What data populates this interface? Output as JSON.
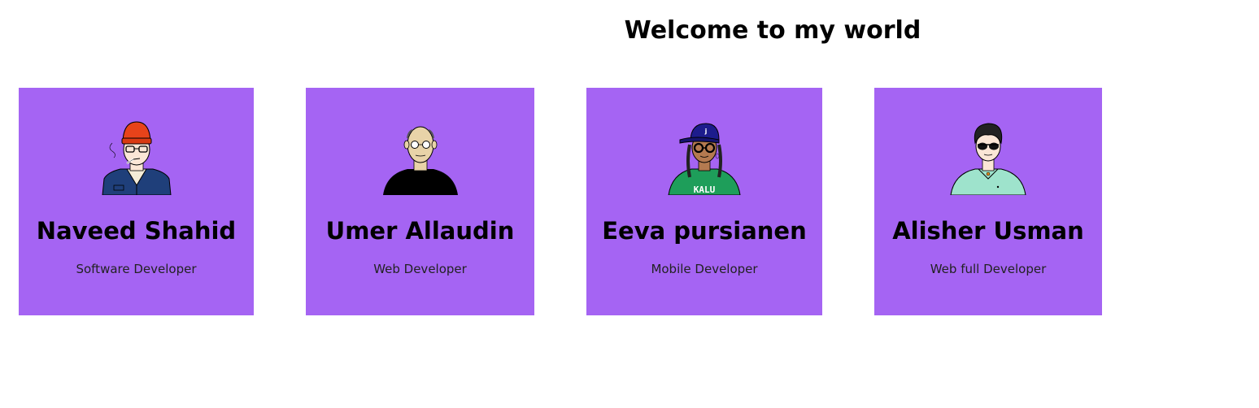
{
  "header": {
    "title": "Welcome to my world"
  },
  "cards": [
    {
      "name": "Naveed Shahid",
      "role": "Software Developer",
      "avatar": "avatar-beanie-glasses-icon"
    },
    {
      "name": "Umer Allaudin",
      "role": "Web Developer",
      "avatar": "avatar-bald-glasses-icon"
    },
    {
      "name": "Eeva pursianen",
      "role": "Mobile Developer",
      "avatar": "avatar-cap-braids-icon",
      "avatar_text": "KALU",
      "cap_letter": "j"
    },
    {
      "name": "Alisher Usman",
      "role": "Web full Developer",
      "avatar": "avatar-sunglasses-icon"
    }
  ],
  "colors": {
    "card_background": "#a564f3",
    "page_background": "#ffffff"
  }
}
